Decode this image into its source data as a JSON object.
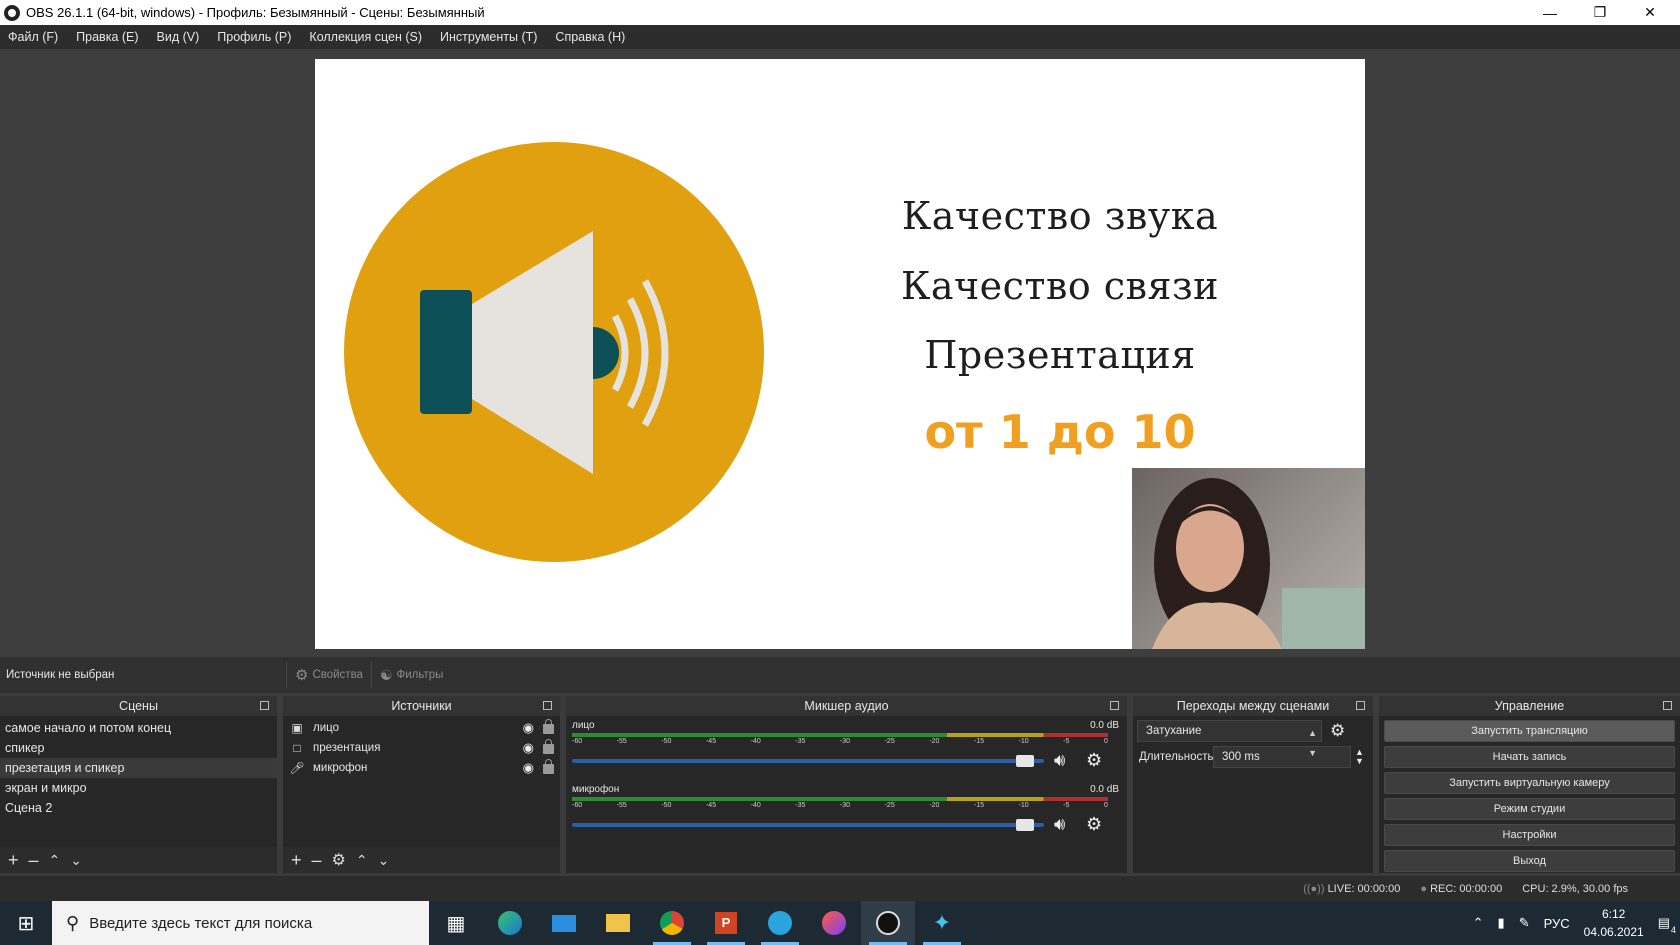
{
  "window": {
    "title": "OBS 26.1.1 (64-bit, windows) - Профиль: Безымянный - Сцены: Безымянный",
    "icon": "obs-icon",
    "controls": [
      "minimize-icon",
      "restore-icon",
      "close-icon"
    ]
  },
  "menu": [
    "Файл (F)",
    "Правка (E)",
    "Вид (V)",
    "Профиль (P)",
    "Коллекция сцен (S)",
    "Инструменты (T)",
    "Справка (H)"
  ],
  "preview": {
    "line1": "Качество звука",
    "line2": "Качество связи",
    "line3": "Презентация",
    "accent": "от 1 до 10",
    "circle_color": "#e0a010",
    "speaker_dark": "#0d4f57",
    "speaker_light": "#e6e3de",
    "accent_color": "#f0a020"
  },
  "context": {
    "no_source": "Источник не выбран",
    "properties": "Свойства",
    "filters": "Фильтры"
  },
  "scenes": {
    "title": "Сцены",
    "items": [
      "самое начало и потом конец",
      "спикер",
      "презетация и спикер",
      "экран и микро",
      "Сцена 2"
    ],
    "selected_index": 2
  },
  "sources": {
    "title": "Источники",
    "items": [
      {
        "name": "лицо",
        "icon": "camera-icon"
      },
      {
        "name": "презентация",
        "icon": "window-icon"
      },
      {
        "name": "микрофон",
        "icon": "microphone-icon"
      }
    ]
  },
  "mixer": {
    "title": "Микшер аудио",
    "ticks": [
      "-60",
      "-55",
      "-50",
      "-45",
      "-40",
      "-35",
      "-30",
      "-25",
      "-20",
      "-15",
      "-10",
      "-5",
      "0"
    ],
    "channels": [
      {
        "name": "лицо",
        "db": "0.0 dB",
        "volume": 0.97
      },
      {
        "name": "микрофон",
        "db": "0.0 dB",
        "volume": 0.97
      }
    ]
  },
  "transitions": {
    "title": "Переходы между сценами",
    "selected": "Затухание",
    "duration_label": "Длительность",
    "duration_value": "300 ms"
  },
  "controls": {
    "title": "Управление",
    "buttons": [
      "Запустить трансляцию",
      "Начать запись",
      "Запустить виртуальную камеру",
      "Режим студии",
      "Настройки",
      "Выход"
    ]
  },
  "status": {
    "live": "LIVE: 00:00:00",
    "rec": "REC: 00:00:00",
    "cpu": "CPU: 2.9%, 30.00 fps"
  },
  "taskbar": {
    "search_placeholder": "Введите здесь текст для поиска",
    "apps": [
      "task-view-icon",
      "edge-icon",
      "mail-icon",
      "explorer-icon",
      "chrome-icon",
      "powerpoint-icon",
      "telegram-icon",
      "browser-icon",
      "obs-icon",
      "app-icon"
    ],
    "lang": "РУС",
    "time": "6:12",
    "date": "04.06.2021",
    "notifications": "4"
  }
}
